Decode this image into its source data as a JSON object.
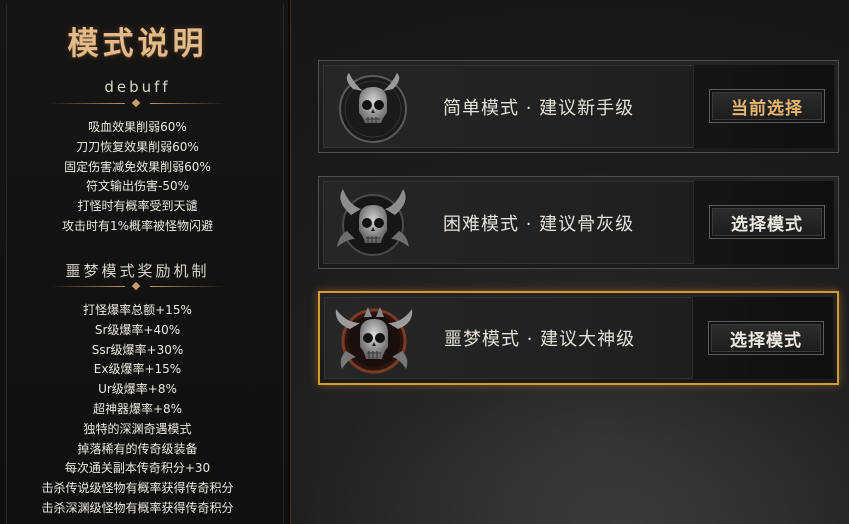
{
  "left_panel": {
    "title": "模式说明",
    "debuff_heading": "debuff",
    "debuff_items": [
      "吸血效果削弱60%",
      "刀刀恢复效果削弱60%",
      "固定伤害减免效果削弱60%",
      "符文输出伤害-50%",
      "打怪时有概率受到天谴",
      "攻击时有1%概率被怪物闪避"
    ],
    "reward_heading": "噩梦模式奖励机制",
    "reward_items": [
      "打怪爆率总额+15%",
      "Sr级爆率+40%",
      "Ssr级爆率+30%",
      "Ex级爆率+15%",
      "Ur级爆率+8%",
      "超神器爆率+8%",
      "独特的深渊奇遇模式",
      "掉落稀有的传奇级装备",
      "每次通关副本传奇积分+30",
      "击杀传说级怪物有概率获得传奇积分",
      "击杀深渊级怪物有概率获得传奇积分"
    ]
  },
  "modes": [
    {
      "label": "简单模式 · 建议新手级",
      "button": "当前选择",
      "icon": "skull-emblem-easy-icon",
      "state": "current"
    },
    {
      "label": "困难模式 · 建议骨灰级",
      "button": "选择模式",
      "icon": "skull-emblem-hard-icon",
      "state": "available"
    },
    {
      "label": "噩梦模式 · 建议大神级",
      "button": "选择模式",
      "icon": "skull-emblem-nightmare-icon",
      "state": "highlighted"
    }
  ],
  "colors": {
    "title_gold": "#e3bb8a",
    "selected_border": "#d89a2c",
    "current_button_text": "#e7b56c",
    "text": "#ece7df"
  }
}
